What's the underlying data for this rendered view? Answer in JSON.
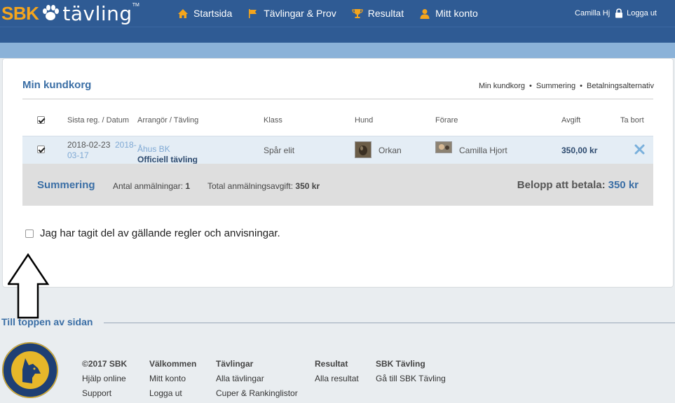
{
  "header": {
    "logo_sbk": "SBK",
    "logo_tavling": "tävling",
    "logo_tm": "TM",
    "nav": [
      {
        "label": "Startsida",
        "icon": "home-icon"
      },
      {
        "label": "Tävlingar & Prov",
        "icon": "flag-icon"
      },
      {
        "label": "Resultat",
        "icon": "trophy-icon"
      },
      {
        "label": "Mitt konto",
        "icon": "user-icon"
      }
    ],
    "user_name": "Camilla Hj",
    "logout_label": "Logga ut"
  },
  "page": {
    "title": "Min kundkorg",
    "breadcrumb": [
      "Min kundkorg",
      "Summering",
      "Betalningsalternativ"
    ]
  },
  "table": {
    "headers": {
      "date": "Sista reg. / Datum",
      "organizer": "Arrangör / Tävling",
      "class": "Klass",
      "dog": "Hund",
      "handler": "Förare",
      "fee": "Avgift",
      "remove": "Ta bort"
    },
    "rows": [
      {
        "checked": true,
        "last_reg": "2018-02-23",
        "date_line1": "2018-",
        "date_line2": "03-17",
        "organizer": "Åhus BK",
        "competition": "Officiell tävling",
        "class": "Spår elit",
        "dog": "Orkan",
        "handler": "Camilla Hjort",
        "fee": "350,00 kr"
      }
    ]
  },
  "summary": {
    "title": "Summering",
    "count_label": "Antal anmälningar:",
    "count_value": "1",
    "total_label": "Total anmälningsavgift:",
    "total_value": "350 kr",
    "pay_label": "Belopp att betala:",
    "pay_value": "350 kr"
  },
  "terms": {
    "checked": false,
    "label": "Jag har tagit del av gällande regler och anvisningar."
  },
  "to_top": "Till toppen av sidan",
  "footer": {
    "columns": [
      {
        "heading": "©2017 SBK",
        "links": [
          "Hjälp online",
          "Support"
        ]
      },
      {
        "heading": "Välkommen",
        "links": [
          "Mitt konto",
          "Logga ut"
        ]
      },
      {
        "heading": "Tävlingar",
        "links": [
          "Alla tävlingar",
          "Cuper & Rankinglistor"
        ]
      },
      {
        "heading": "Resultat",
        "links": [
          "Alla resultat"
        ]
      },
      {
        "heading": "SBK Tävling",
        "links": [
          "Gå till SBK Tävling"
        ]
      }
    ]
  },
  "colors": {
    "header_bg": "#2f5b94",
    "accent": "#3a6ea5",
    "logo_orange": "#f5a51c",
    "nav_icon": "#f5a51c"
  }
}
